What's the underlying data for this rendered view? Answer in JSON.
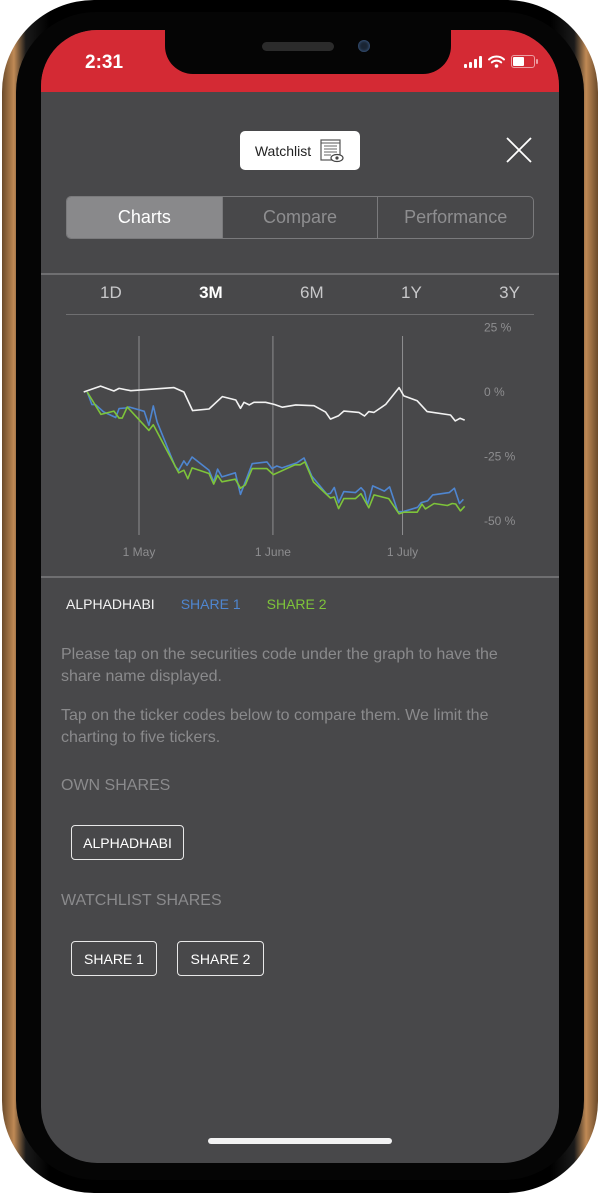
{
  "status_bar": {
    "time": "2:31",
    "icons": [
      "signal-icon",
      "wifi-icon",
      "battery-icon"
    ]
  },
  "header": {
    "watchlist_label": "Watchlist",
    "watchlist_icon": "watchlist-eye-icon",
    "close_icon": "close-icon"
  },
  "tabs": [
    {
      "label": "Charts",
      "active": true
    },
    {
      "label": "Compare",
      "active": false
    },
    {
      "label": "Performance",
      "active": false
    }
  ],
  "ranges": [
    {
      "label": "1D",
      "active": false
    },
    {
      "label": "3M",
      "active": true
    },
    {
      "label": "6M",
      "active": false
    },
    {
      "label": "1Y",
      "active": false
    },
    {
      "label": "3Y",
      "active": false
    }
  ],
  "colors": {
    "status_bar": "#d42a34",
    "background": "#48484a",
    "alphadhabi": "#f2f2f2",
    "share1": "#4f86d0",
    "share2": "#7ec43a"
  },
  "chart_data": {
    "type": "line",
    "title": "",
    "xlabel": "",
    "ylabel": "",
    "x_unit": "days since 1 May",
    "x_ticks": [
      {
        "label": "1 May",
        "value": 0
      },
      {
        "label": "1 June",
        "value": 31
      },
      {
        "label": "1 July",
        "value": 61
      }
    ],
    "y_ticks": [
      {
        "label": "25 %",
        "value": 25
      },
      {
        "label": "0 %",
        "value": 0
      },
      {
        "label": "-25 %",
        "value": -25
      },
      {
        "label": "-50 %",
        "value": -50
      }
    ],
    "ylim": [
      -50,
      25
    ],
    "xlim": [
      -13,
      75
    ],
    "grid": "vertical at x ticks",
    "legend": "below-left",
    "series": [
      {
        "name": "ALPHADHABI",
        "color": "#f2f2f2",
        "x": [
          -12.8,
          -8.9,
          -5.8,
          -4.6,
          -1.9,
          8.1,
          10.4,
          12.4,
          16.2,
          19.3,
          22.4,
          23.5,
          24.3,
          25.5,
          26.6,
          29.3,
          31.3,
          33.2,
          36.3,
          40.5,
          43.2,
          44.3,
          46.2,
          47.4,
          50.9,
          52.2,
          53.2,
          54.4,
          57.1,
          60.2,
          61.3,
          64.4,
          66.7,
          72.1,
          73.2,
          74.3,
          75.4
        ],
        "y": [
          0,
          2.3,
          0.4,
          1.4,
          0.5,
          1.7,
          0,
          -7.2,
          -6.6,
          -1.8,
          -3.1,
          -6.3,
          -4,
          -5,
          -4,
          -4,
          -4.8,
          -5.9,
          -5,
          -5.3,
          -7.8,
          -10.5,
          -9.2,
          -7.4,
          -7.9,
          -9.3,
          -7.6,
          -7.9,
          -4.8,
          1.7,
          -1.5,
          -3.4,
          -7.6,
          -8.9,
          -11.2,
          -10.2,
          -10.9
        ]
      },
      {
        "name": "SHARE 1",
        "color": "#4f86d0",
        "x": [
          -12,
          -10.9,
          -10.1,
          -8.2,
          -5.4,
          -4.6,
          -3.1,
          -2.3,
          1.2,
          2.3,
          3.3,
          4.2,
          8.4,
          9.2,
          10.4,
          11.1,
          12.3,
          16.2,
          17.3,
          18.2,
          19.2,
          22.3,
          23.5,
          26.2,
          29.6,
          30.8,
          31.9,
          33.1,
          36.5,
          38.2,
          40,
          43.5,
          44.3,
          45.2,
          46.2,
          47.4,
          50.1,
          51.4,
          52.2,
          52.9,
          54.1,
          56.8,
          58,
          59.9,
          61.1,
          64.5,
          65.3,
          66.8,
          68,
          71.8,
          73,
          74.2,
          75.1
        ],
        "y": [
          0,
          -4.9,
          -4.9,
          -7.7,
          -9.9,
          -6.4,
          -6.2,
          -5.8,
          -7.5,
          -12.9,
          -5.4,
          -11.6,
          -29,
          -30.3,
          -26.7,
          -28.4,
          -25.2,
          -30.3,
          -34.8,
          -29.9,
          -32.9,
          -31.3,
          -39.7,
          -27.8,
          -27.1,
          -29.7,
          -28.7,
          -29.4,
          -27.5,
          -25.6,
          -32.6,
          -39.6,
          -39.3,
          -37,
          -42.9,
          -38.6,
          -39,
          -37.1,
          -38.6,
          -43.8,
          -36.4,
          -38.4,
          -36.8,
          -46.4,
          -46.4,
          -44.7,
          -42.9,
          -42.2,
          -39.9,
          -39,
          -37.3,
          -43.2,
          -41.6
        ]
      },
      {
        "name": "SHARE 2",
        "color": "#7ec43a",
        "x": [
          -12,
          -8.8,
          -5.8,
          -4.6,
          -3.9,
          -2.7,
          2.3,
          3.3,
          9.2,
          10.4,
          11.3,
          12.3,
          16.2,
          17.3,
          18.2,
          19.2,
          22.3,
          23.5,
          24.6,
          26.2,
          29.6,
          31.1,
          36.1,
          37.3,
          38.4,
          40.4,
          44.3,
          45.2,
          46.2,
          47.4,
          50.1,
          51.4,
          53.2,
          54.4,
          57.8,
          60.2,
          61.3,
          64.4,
          65.5,
          66.3,
          68.3,
          71.4,
          72.5,
          73.3,
          74.4,
          75.4
        ],
        "y": [
          0,
          -8.7,
          -7.4,
          -10.1,
          -10.1,
          -5.8,
          -14.9,
          -12.7,
          -31.3,
          -30.3,
          -33.6,
          -29.4,
          -31.6,
          -35.7,
          -32.3,
          -34.8,
          -33.8,
          -37.3,
          -36,
          -29.7,
          -29.7,
          -32,
          -28.2,
          -28.2,
          -27.1,
          -34.9,
          -41.1,
          -40.7,
          -45.2,
          -41.3,
          -41.3,
          -39.4,
          -44.9,
          -39.9,
          -41.3,
          -47.2,
          -46.6,
          -46.6,
          -43.5,
          -45.3,
          -43.2,
          -44,
          -43.2,
          -43.4,
          -46.1,
          -44.3
        ]
      }
    ]
  },
  "legend": [
    "ALPHADHABI",
    "SHARE 1",
    "SHARE 2"
  ],
  "info": {
    "p1": "Please tap on the securities code under the graph to have the share name displayed.",
    "p2": "Tap on the ticker codes below to compare them. We limit the charting to five tickers."
  },
  "own_shares": {
    "title": "OWN SHARES",
    "items": [
      "ALPHADHABI"
    ]
  },
  "watchlist_shares": {
    "title": "WATCHLIST SHARES",
    "items": [
      "SHARE 1",
      "SHARE 2"
    ]
  }
}
